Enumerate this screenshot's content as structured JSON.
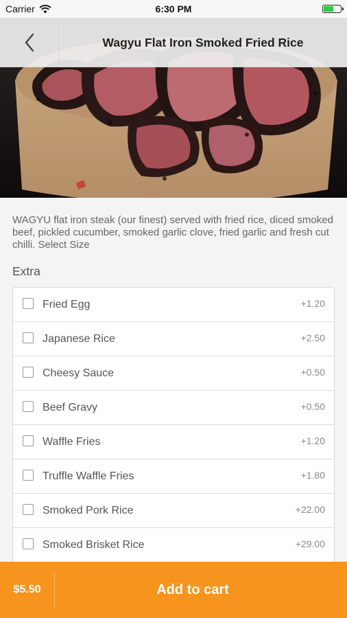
{
  "status_bar": {
    "carrier": "Carrier",
    "time": "6:30 PM"
  },
  "nav": {
    "title": "Wagyu Flat Iron Smoked Fried Rice",
    "back_icon": "chevron-left-icon"
  },
  "product": {
    "image_alt": "Wagyu flat iron steak slices in a paper bowl",
    "description": "WAGYU flat iron steak (our finest) served with fried rice, diced smoked beef, pickled cucumber, smoked garlic clove, fried garlic and fresh cut chilli. Select Size"
  },
  "extras": {
    "label": "Extra",
    "items": [
      {
        "name": "Fried Egg",
        "price": "+1.20"
      },
      {
        "name": "Japanese Rice",
        "price": "+2.50"
      },
      {
        "name": "Cheesy Sauce",
        "price": "+0.50"
      },
      {
        "name": "Beef Gravy",
        "price": "+0.50"
      },
      {
        "name": "Waffle Fries",
        "price": "+1.20"
      },
      {
        "name": "Truffle Waffle Fries",
        "price": "+1.80"
      },
      {
        "name": "Smoked Pork Rice",
        "price": "+22.00"
      },
      {
        "name": "Smoked Brisket Rice",
        "price": "+29.00"
      }
    ]
  },
  "cart": {
    "price": "$5.50",
    "button_label": "Add to cart"
  },
  "colors": {
    "accent": "#f7941d",
    "background": "#f4f4f4"
  }
}
